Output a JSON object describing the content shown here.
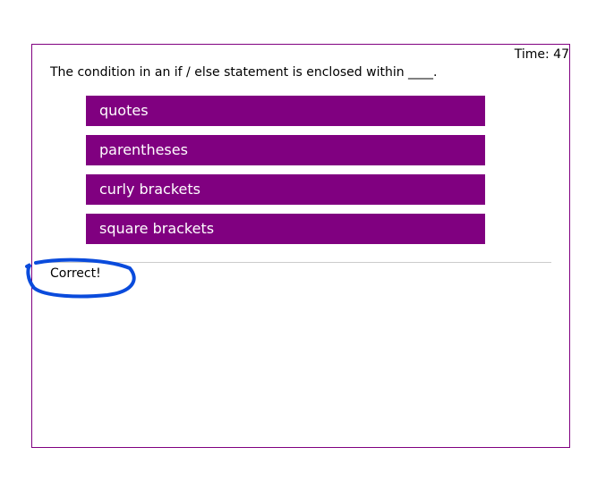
{
  "timer": "Time: 47",
  "question": "The condition in an if / else statement is enclosed within ____.",
  "options": [
    "quotes",
    "parentheses",
    "curly brackets",
    "square brackets"
  ],
  "feedback": "Correct!",
  "colors": {
    "accent": "#800080",
    "annotation": "#0a4bdc"
  }
}
